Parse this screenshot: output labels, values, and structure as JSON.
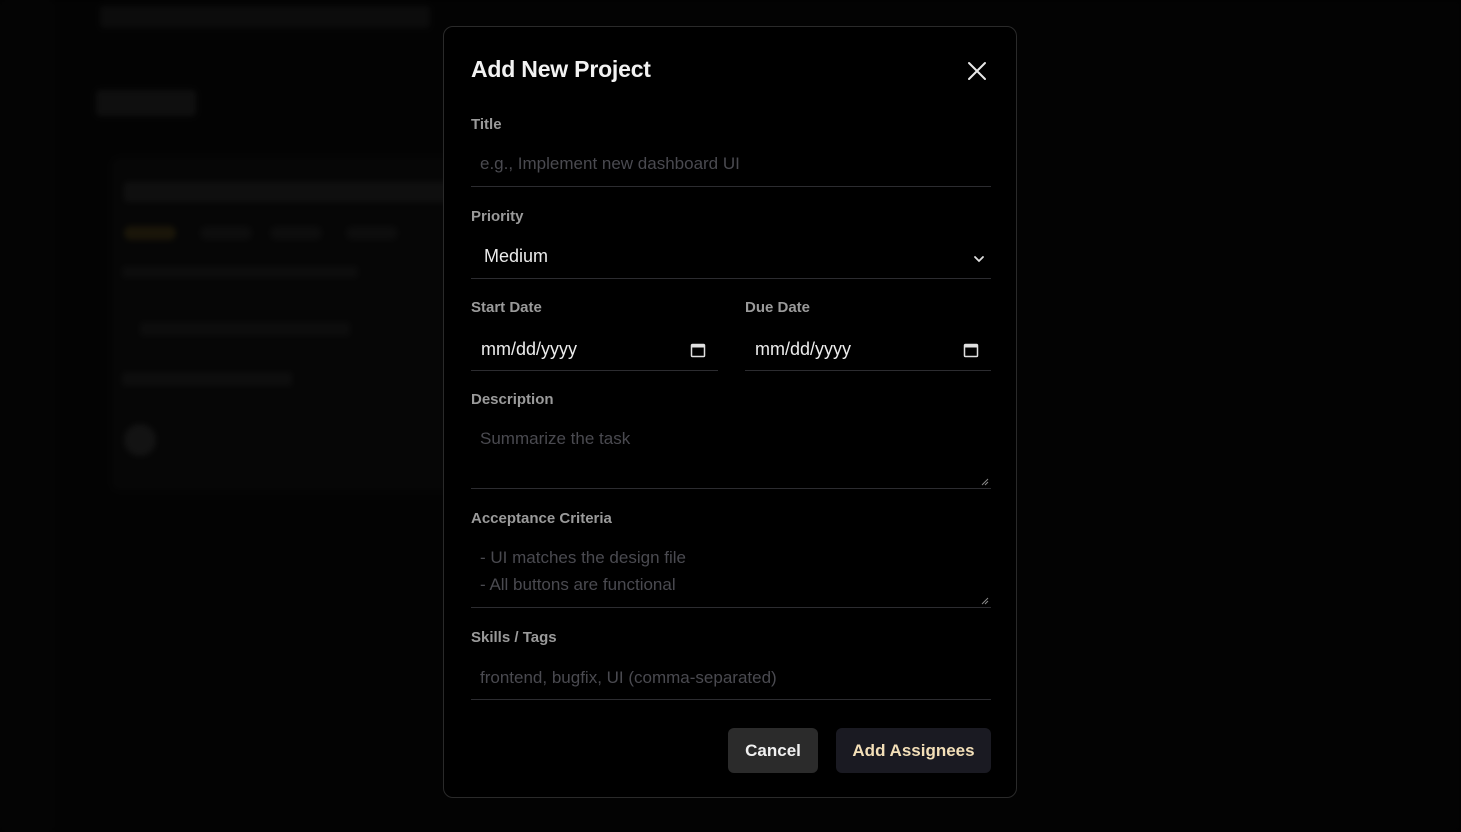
{
  "modal": {
    "title": "Add New Project",
    "close_icon": "close-icon"
  },
  "form": {
    "title_label": "Title",
    "title_placeholder": "e.g., Implement new dashboard UI",
    "priority_label": "Priority",
    "priority_value": "Medium",
    "start_date_label": "Start Date",
    "start_date_value": "mm/dd/yyyy",
    "due_date_label": "Due Date",
    "due_date_value": "mm/dd/yyyy",
    "description_label": "Description",
    "description_placeholder": "Summarize the task",
    "criteria_label": "Acceptance Criteria",
    "criteria_placeholder_line1": "- UI matches the design file",
    "criteria_placeholder_line2": "- All buttons are functional",
    "skills_label": "Skills / Tags",
    "skills_placeholder": "frontend, bugfix, UI (comma-separated)"
  },
  "actions": {
    "cancel_label": "Cancel",
    "add_assignees_label": "Add Assignees"
  },
  "colors": {
    "modal_bg": "#000000",
    "border": "#2a2a2a",
    "label": "#9a9a9a",
    "placeholder": "#4a4a50",
    "accent_text": "#f3dfb8"
  }
}
